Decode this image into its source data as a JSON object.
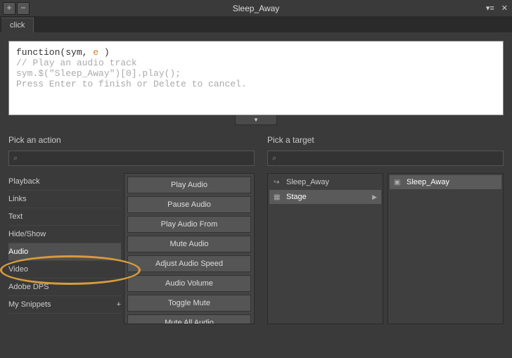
{
  "titlebar": {
    "title": "Sleep_Away"
  },
  "tab": {
    "label": "click"
  },
  "code": {
    "line1_pre": "function(sym, ",
    "line1_param": "e",
    "line1_post": " )",
    "line2": "// Play an audio track",
    "line3": "sym.$(\"Sleep_Away\")[0].play();",
    "line4": "Press Enter to finish or Delete to cancel."
  },
  "action_panel": {
    "heading": "Pick an action",
    "categories": [
      {
        "label": "Playback"
      },
      {
        "label": "Links"
      },
      {
        "label": "Text"
      },
      {
        "label": "Hide/Show"
      },
      {
        "label": "Audio"
      },
      {
        "label": "Video"
      },
      {
        "label": "Adobe DPS"
      },
      {
        "label": "My Snippets"
      }
    ],
    "plus": "+",
    "actions": [
      "Play Audio",
      "Pause Audio",
      "Play Audio From",
      "Mute Audio",
      "Adjust Audio Speed",
      "Audio Volume",
      "Toggle Mute",
      "Mute All Audio"
    ]
  },
  "target_panel": {
    "heading": "Pick a target",
    "col1": [
      {
        "label": "Sleep_Away",
        "icon": "↪"
      },
      {
        "label": "Stage",
        "icon": "▦",
        "expandable": true,
        "selected": true
      }
    ],
    "col2": [
      {
        "label": "Sleep_Away",
        "icon": "▣",
        "selected": true
      }
    ]
  }
}
